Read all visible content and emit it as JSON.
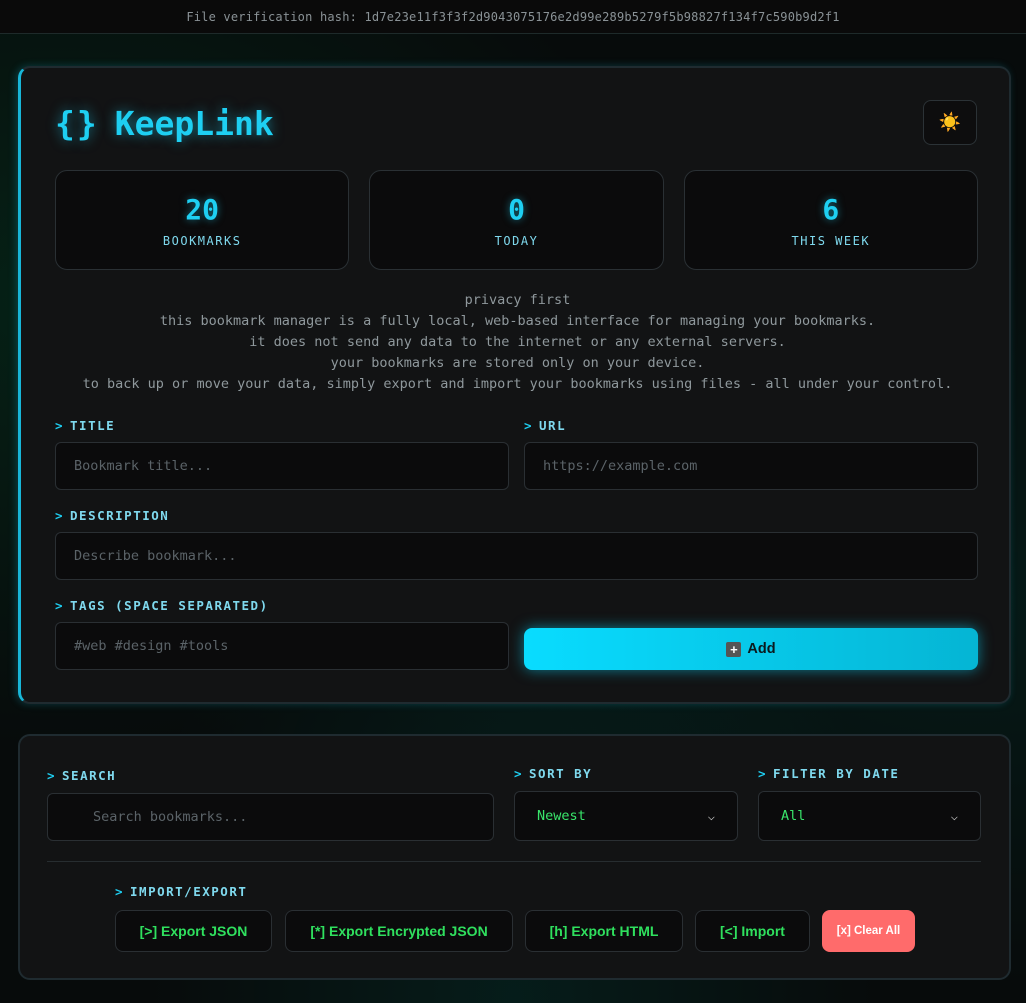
{
  "hash_bar": {
    "text": "File verification hash: 1d7e23e11f3f3f2d9043075176e2d99e289b5279f5b98827f134f7c590b9d2f1"
  },
  "header": {
    "logo_braces": "{}",
    "app_title": "KeepLink",
    "theme_icon": "sun-icon",
    "theme_glyph": "☀️"
  },
  "stats": [
    {
      "value": "20",
      "label": "BOOKMARKS"
    },
    {
      "value": "0",
      "label": "TODAY"
    },
    {
      "value": "6",
      "label": "THIS WEEK"
    }
  ],
  "privacy": {
    "lines": [
      "privacy first",
      "this bookmark manager is a fully local, web-based interface for managing your bookmarks.",
      "it does not send any data to the internet or any external servers.",
      "your bookmarks are stored only on your device.",
      "to back up or move your data, simply export and import your bookmarks using files - all under your control."
    ]
  },
  "form": {
    "prompt": ">",
    "title_label": "TITLE",
    "title_placeholder": "Bookmark title...",
    "url_label": "URL",
    "url_placeholder": "https://example.com",
    "description_label": "DESCRIPTION",
    "description_placeholder": "Describe bookmark...",
    "tags_label": "TAGS (SPACE SEPARATED)",
    "tags_placeholder": "#web #design #tools",
    "add_icon": "plus-icon",
    "add_glyph": "+",
    "add_label": "Add"
  },
  "controls": {
    "search_label": "SEARCH",
    "search_placeholder": "Search bookmarks...",
    "sort_label": "SORT BY",
    "sort_value": "Newest",
    "filter_label": "FILTER BY DATE",
    "filter_value": "All",
    "import_export_label": "IMPORT/EXPORT",
    "buttons": [
      "[>] Export JSON",
      "[*] Export Encrypted JSON",
      "[h] Export HTML",
      "[<] Import",
      "[x] Clear All"
    ]
  },
  "colors": {
    "accent": "#1ecff2",
    "success_text": "#2fe05e",
    "danger": "#ff6b6b",
    "card_bg": "#121314"
  }
}
